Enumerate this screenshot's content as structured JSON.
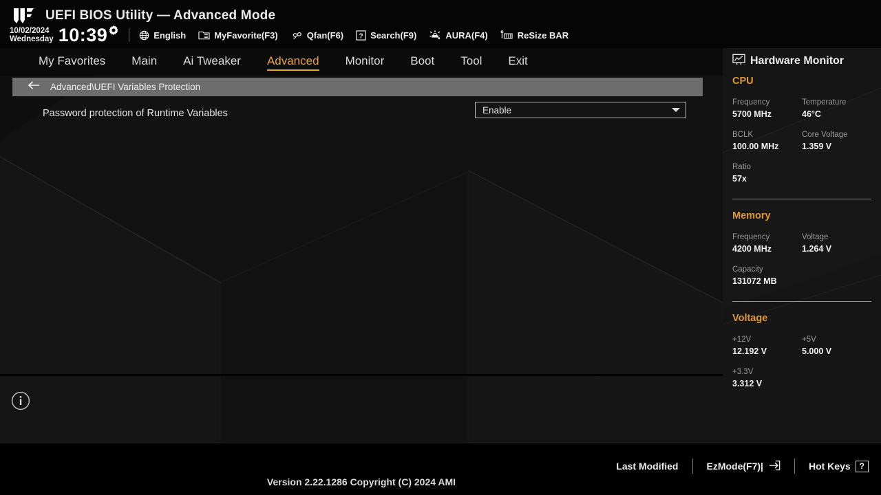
{
  "header": {
    "app_title": "UEFI BIOS Utility — Advanced Mode",
    "logo_name": "tuf-gaming-logo",
    "date": "10/02/2024",
    "weekday": "Wednesday",
    "time": "10:39",
    "gear_icon": "gear-icon",
    "shortcuts": [
      {
        "label": "English",
        "icon": "globe-icon"
      },
      {
        "label": "MyFavorite(F3)",
        "icon": "favorites-list-icon"
      },
      {
        "label": "Qfan(F6)",
        "icon": "fan-icon"
      },
      {
        "label": "Search(F9)",
        "icon": "question-box-icon"
      },
      {
        "label": "AURA(F4)",
        "icon": "aura-light-icon"
      },
      {
        "label": "ReSize BAR",
        "icon": "resize-bar-icon"
      }
    ]
  },
  "tabs": [
    {
      "label": "My Favorites",
      "active": false
    },
    {
      "label": "Main",
      "active": false
    },
    {
      "label": "Ai Tweaker",
      "active": false
    },
    {
      "label": "Advanced",
      "active": true
    },
    {
      "label": "Monitor",
      "active": false
    },
    {
      "label": "Boot",
      "active": false
    },
    {
      "label": "Tool",
      "active": false
    },
    {
      "label": "Exit",
      "active": false
    }
  ],
  "breadcrumb": {
    "back_icon": "back-arrow-icon",
    "path": "Advanced\\UEFI Variables Protection"
  },
  "setting": {
    "label": "Password protection of Runtime Variables",
    "value": "Enable",
    "caret_icon": "chevron-down-icon"
  },
  "info_icon": "info-icon",
  "hardware_monitor": {
    "title": "Hardware Monitor",
    "title_icon": "monitor-icon",
    "sections": [
      {
        "name": "CPU",
        "items": [
          {
            "key": "Frequency",
            "value": "5700 MHz",
            "full": false
          },
          {
            "key": "Temperature",
            "value": "46°C",
            "full": false
          },
          {
            "key": "BCLK",
            "value": "100.00 MHz",
            "full": false
          },
          {
            "key": "Core Voltage",
            "value": "1.359 V",
            "full": false
          },
          {
            "key": "Ratio",
            "value": "57x",
            "full": true
          }
        ]
      },
      {
        "name": "Memory",
        "items": [
          {
            "key": "Frequency",
            "value": "4200 MHz",
            "full": false
          },
          {
            "key": "Voltage",
            "value": "1.264 V",
            "full": false
          },
          {
            "key": "Capacity",
            "value": "131072 MB",
            "full": true
          }
        ]
      },
      {
        "name": "Voltage",
        "items": [
          {
            "key": "+12V",
            "value": "12.192 V",
            "full": false
          },
          {
            "key": "+5V",
            "value": "5.000 V",
            "full": false
          },
          {
            "key": "+3.3V",
            "value": "3.312 V",
            "full": true
          }
        ]
      }
    ]
  },
  "footer": {
    "version": "Version 2.22.1286 Copyright (C) 2024 AMI",
    "last_modified": "Last Modified",
    "ez_mode": "EzMode(F7)|",
    "ez_mode_icon": "exit-arrow-icon",
    "hot_keys": "Hot Keys",
    "hot_keys_badge": "?"
  },
  "colors": {
    "accent": "#e8a33d",
    "breadcrumb_bg": "#6d6d6d",
    "panel_bg": "#121212",
    "hw_bg": "#151515"
  }
}
